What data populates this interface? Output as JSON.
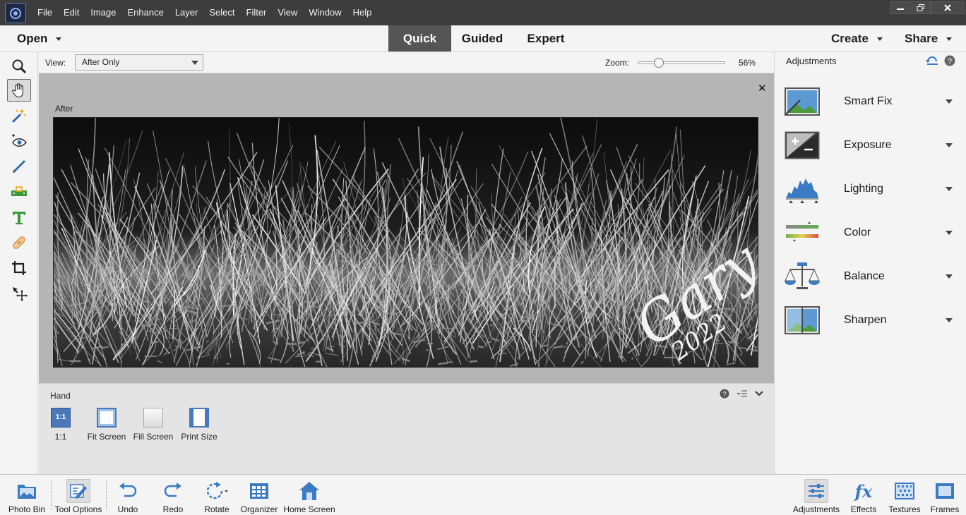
{
  "menubar": {
    "items": [
      "File",
      "Edit",
      "Image",
      "Enhance",
      "Layer",
      "Select",
      "Filter",
      "View",
      "Window",
      "Help"
    ]
  },
  "window_controls": {
    "minimize": "minimize-icon",
    "maximize": "restore-icon",
    "close": "close-icon"
  },
  "modebar": {
    "open_label": "Open",
    "tabs": [
      "Quick",
      "Guided",
      "Expert"
    ],
    "active_tab": "Quick",
    "create_label": "Create",
    "share_label": "Share"
  },
  "toolbox": {
    "tools": [
      "zoom-tool",
      "hand-tool",
      "quick-selection-tool",
      "red-eye-tool",
      "whiten-teeth-tool",
      "straighten-tool",
      "type-tool",
      "spot-healing-tool",
      "crop-tool",
      "move-tool"
    ],
    "active": "hand-tool"
  },
  "optbar": {
    "view_label": "View:",
    "view_value": "After Only",
    "zoom_label": "Zoom:",
    "zoom_value": "56%",
    "zoom_fraction": 0.2
  },
  "canvas": {
    "after_label": "After",
    "watermark_name": "Gary",
    "watermark_year": "2022"
  },
  "tool_options": {
    "tool_name": "Hand",
    "buttons": [
      "1:1",
      "Fit Screen",
      "Fill Screen",
      "Print Size"
    ],
    "one_to_one_icon_text": "1:1"
  },
  "adjustments": {
    "title": "Adjustments",
    "items": [
      "Smart Fix",
      "Exposure",
      "Lighting",
      "Color",
      "Balance",
      "Sharpen"
    ]
  },
  "bottombar": {
    "left": [
      "Photo Bin",
      "Tool Options",
      "Undo",
      "Redo",
      "Rotate",
      "Organizer",
      "Home Screen"
    ],
    "right": [
      "Adjustments",
      "Effects",
      "Textures",
      "Frames"
    ],
    "effects_icon_text": "fx"
  },
  "colors": {
    "titlebar": "#3d3d3d",
    "active_tab": "#555555",
    "accent_blue": "#2f6db5",
    "panel": "#f4f4f4"
  }
}
